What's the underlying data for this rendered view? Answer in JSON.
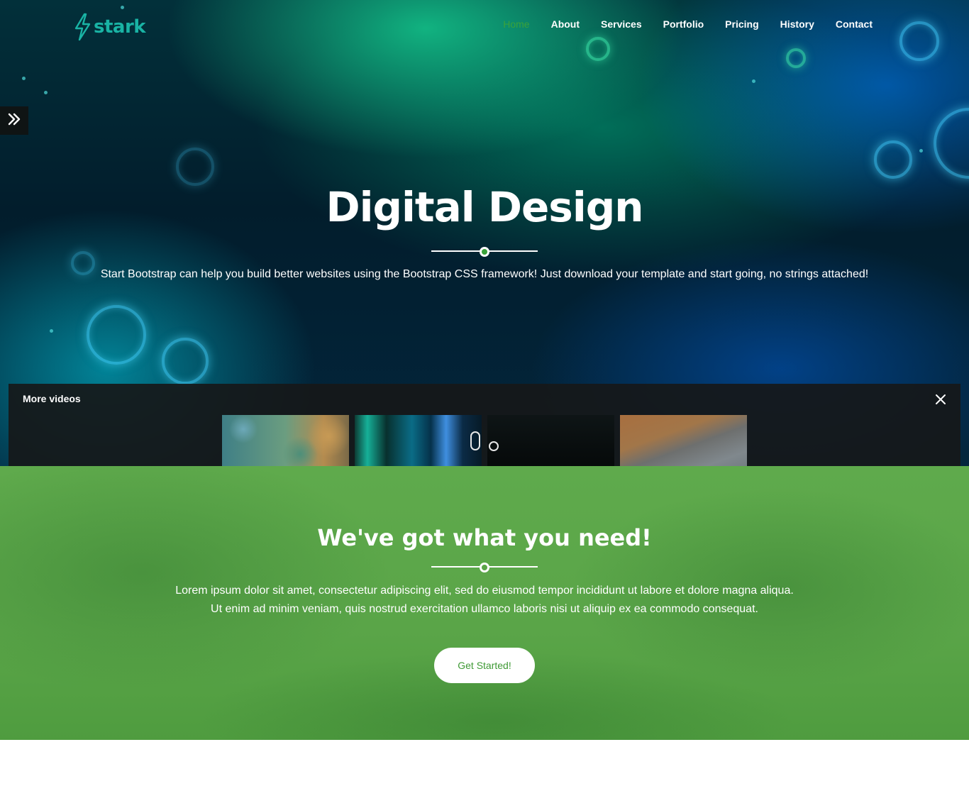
{
  "brand": {
    "name": "stark",
    "color": "#19b3a4"
  },
  "nav": {
    "items": [
      {
        "label": "Home",
        "active": true
      },
      {
        "label": "About",
        "active": false
      },
      {
        "label": "Services",
        "active": false
      },
      {
        "label": "Portfolio",
        "active": false
      },
      {
        "label": "Pricing",
        "active": false
      },
      {
        "label": "History",
        "active": false
      },
      {
        "label": "Contact",
        "active": false
      }
    ],
    "active_color": "#3aa23a"
  },
  "hero": {
    "title": "Digital Design",
    "text": "Start Bootstrap can help you build better websites using the Bootstrap CSS framework! Just download your template and start going, no strings attached!"
  },
  "videos": {
    "title": "More videos",
    "thumbnails": [
      "underwater-rocks",
      "aurora-lights",
      "dark-video",
      "beach-shore"
    ]
  },
  "need": {
    "title": "We've got what you need!",
    "text_line1": "Lorem ipsum dolor sit amet, consectetur adipiscing elit, sed do eiusmod tempor incididunt ut labore et dolore magna aliqua.",
    "text_line2": "Ut enim ad minim veniam, quis nostrud exercitation ullamco laboris nisi ut aliquip ex ea commodo consequat.",
    "button_label": "Get Started!",
    "accent": "#3f9a35"
  },
  "icons": {
    "logo": "lightning-icon",
    "side_toggle": "double-chevron-right-icon",
    "close": "close-icon"
  }
}
